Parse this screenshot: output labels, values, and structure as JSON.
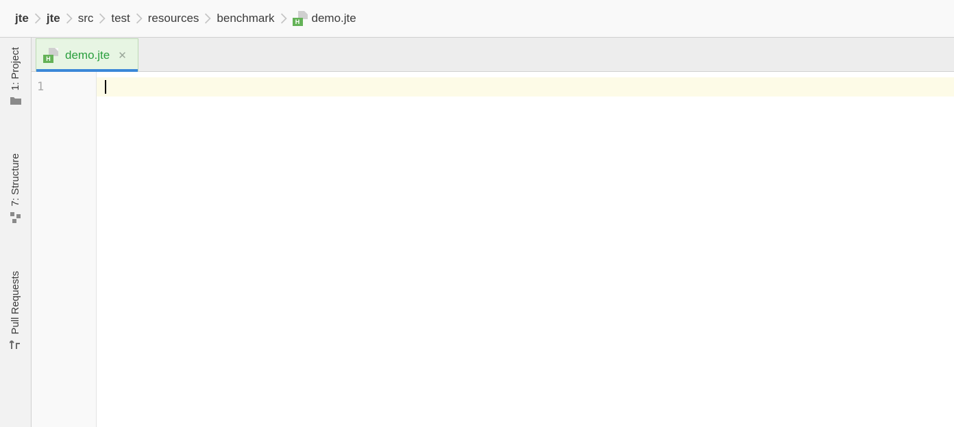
{
  "breadcrumb": {
    "items": [
      {
        "label": "jte",
        "bold": true
      },
      {
        "label": "jte",
        "bold": true
      },
      {
        "label": "src",
        "bold": false
      },
      {
        "label": "test",
        "bold": false
      },
      {
        "label": "resources",
        "bold": false
      },
      {
        "label": "benchmark",
        "bold": false
      },
      {
        "label": "demo.jte",
        "bold": false,
        "icon": true
      }
    ]
  },
  "tools": {
    "project": {
      "label": "1: Project"
    },
    "structure": {
      "label": "7: Structure"
    },
    "pullrequests": {
      "label": "Pull Requests"
    }
  },
  "tabs": {
    "active": {
      "title": "demo.jte"
    }
  },
  "editor": {
    "line1": "1",
    "content": ""
  },
  "file_icon": {
    "badge": "H"
  }
}
